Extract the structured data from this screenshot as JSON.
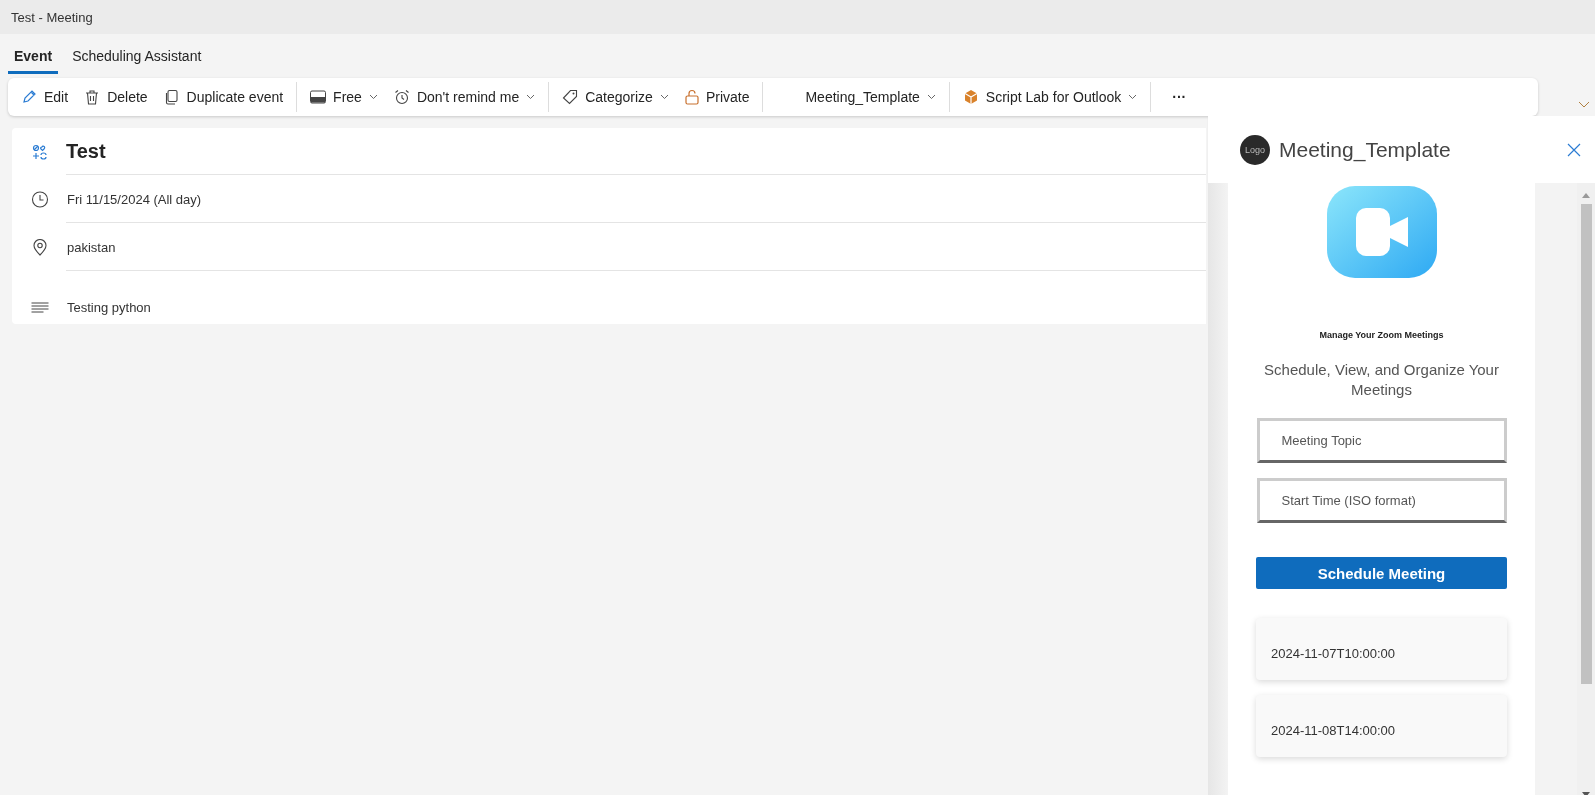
{
  "window": {
    "title": "Test - Meeting"
  },
  "tabs": [
    {
      "label": "Event",
      "selected": true
    },
    {
      "label": "Scheduling Assistant",
      "selected": false
    }
  ],
  "toolbar": {
    "groups": [
      [
        {
          "label": "Edit",
          "dropdown": false
        },
        {
          "label": "Delete",
          "dropdown": false
        },
        {
          "label": "Duplicate event",
          "dropdown": false
        }
      ],
      [
        {
          "label": "Free",
          "dropdown": true
        },
        {
          "label": "Don't remind me",
          "dropdown": true
        }
      ],
      [
        {
          "label": "Categorize",
          "dropdown": true
        },
        {
          "label": "Private",
          "dropdown": false
        }
      ],
      [
        {
          "label": "Meeting_Template",
          "dropdown": true
        }
      ],
      [
        {
          "label": "Script Lab for Outlook",
          "dropdown": true
        }
      ],
      [
        {
          "label": "···",
          "dropdown": false
        }
      ]
    ]
  },
  "event": {
    "title": "Test",
    "date": "Fri 11/15/2024 (All day)",
    "location": "pakistan",
    "body": "Testing python"
  },
  "addin": {
    "logo": "Logo",
    "title": "Meeting_Template",
    "heading": "Manage Your Zoom Meetings",
    "subheading": "Schedule, View, and Organize Your Meetings",
    "fields": [
      {
        "placeholder": "Meeting Topic"
      },
      {
        "placeholder": "Start Time (ISO format)"
      }
    ],
    "button": "Schedule Meeting",
    "meetings": [
      {
        "time": "2024-11-07T10:00:00"
      },
      {
        "time": "2024-11-08T14:00:00"
      }
    ]
  }
}
